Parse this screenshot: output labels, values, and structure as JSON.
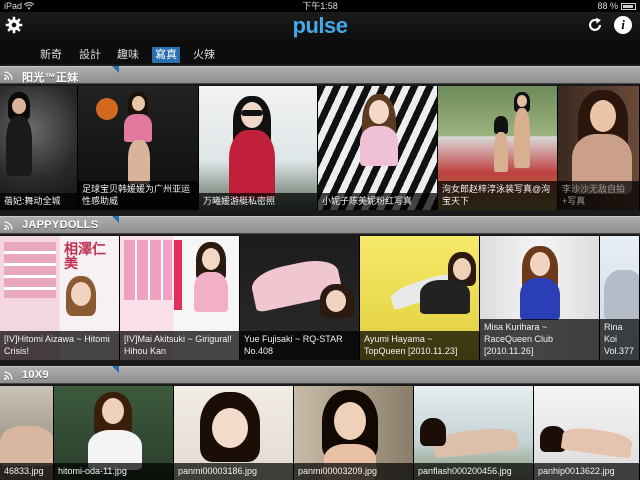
{
  "status_bar": {
    "carrier": "iPad",
    "time": "下午1:58",
    "battery_pct": "88 %"
  },
  "app": {
    "logo": "pulse"
  },
  "toolbar": {
    "settings_icon": "gear-icon",
    "refresh_icon": "refresh-icon",
    "info_icon": "info-icon",
    "info_glyph": "i"
  },
  "tabs": [
    {
      "label": "新奇",
      "active": false
    },
    {
      "label": "設計",
      "active": false
    },
    {
      "label": "趣味",
      "active": false
    },
    {
      "label": "寫真",
      "active": true
    },
    {
      "label": "火辣",
      "active": false
    }
  ],
  "sections": [
    {
      "title": "阳光™正妹",
      "items": [
        {
          "caption": "蓓妃:舞动全城"
        },
        {
          "caption": "足球宝贝韩媛媛为广州亚运性感助威"
        },
        {
          "caption": "万曦媛游艇私密照"
        },
        {
          "caption": "小妮子陈美妮粉红写真"
        },
        {
          "caption": "洵女郎赵梓淳泳装写真@洵宝天下"
        },
        {
          "caption": "李沙沙无敌自拍+写真"
        }
      ]
    },
    {
      "title": "JAPPYDOLLS",
      "items": [
        {
          "caption": "[IV]Hitomi Aizawa ~ Hitomi Crisis!",
          "cover_text": "相澤仁美"
        },
        {
          "caption": "[IV]Mai Akitsuki ~ Girigural! Hihou Kan"
        },
        {
          "caption": "Yue Fujisaki ~ RQ-STAR No.408"
        },
        {
          "caption": "Ayumi Hayama ~ TopQueen [2010.11.23]"
        },
        {
          "caption": "Misa Kurihara ~ RaceQueen Club [2010.11.26]"
        },
        {
          "caption": "Rina Koi Vol.377"
        }
      ]
    },
    {
      "title": "10X9",
      "items": [
        {
          "caption": "46833.jpg"
        },
        {
          "caption": "hitomi-oda-11.jpg"
        },
        {
          "caption": "panmi00003186.jpg"
        },
        {
          "caption": "panmi00003209.jpg"
        },
        {
          "caption": "panflash000200456.jpg"
        },
        {
          "caption": "panhip0013622.jpg"
        }
      ]
    }
  ]
}
